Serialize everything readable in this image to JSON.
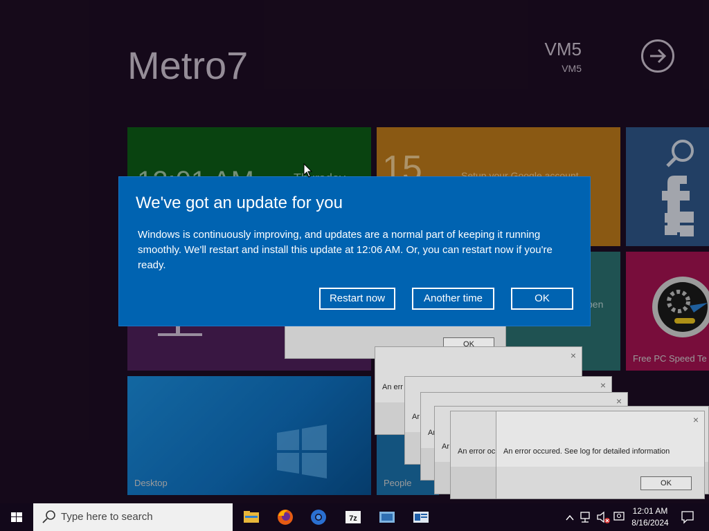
{
  "start_screen": {
    "title": "Metro7",
    "user_name": "VM5",
    "user_sub": "VM5"
  },
  "tiles": {
    "clock_text": "12:01 AM",
    "clock_day": "Thursday",
    "calendar_day": "15",
    "google_text": "Setup your Google account",
    "open_text": "pen",
    "speedtest_label": "Free PC Speed Te",
    "desktop_label": "Desktop",
    "people_label": "People"
  },
  "error_dialog": {
    "message": "An error occured. See log for detailed information",
    "message_partial_1": "An err",
    "message_partial_2": "Ar",
    "message_partial_3": "Ar",
    "message_partial_4": "Ar",
    "message_partial_5": "An error oc",
    "ok_label": "OK",
    "close_label": "×"
  },
  "update_dialog": {
    "title": "We've got an update for you",
    "body": "Windows is continuously improving, and updates are a normal part of keeping it running smoothly. We'll restart and install this update at 12:06 AM. Or, you can restart now if you're ready.",
    "restart_label": "Restart now",
    "another_label": "Another time",
    "ok_label": "OK"
  },
  "taskbar": {
    "search_placeholder": "Type here to search",
    "time": "12:01 AM",
    "date": "8/16/2024",
    "apps": [
      "file-explorer",
      "firefox",
      "chrome",
      "7zip",
      "remote-desktop",
      "app-window"
    ]
  },
  "colors": {
    "background": "#1d0d23",
    "update_blue": "#0063b1",
    "tile_green": "#0c5a16",
    "tile_orange": "#b9771a",
    "tile_blue": "#2e5486",
    "tile_teal": "#2a6e6e",
    "tile_magenta": "#a0124f",
    "tile_purple": "#4d1f58",
    "tile_desktop": "#0f6fbd"
  }
}
